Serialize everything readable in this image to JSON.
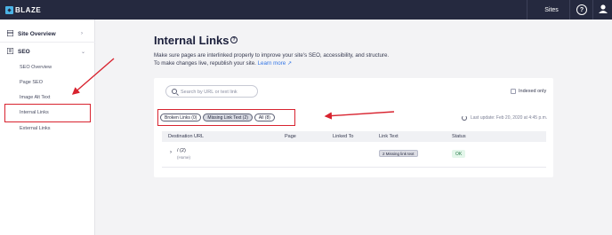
{
  "topbar": {
    "logo": "BLAZE",
    "sites_label": "Sites",
    "help_glyph": "?",
    "icons": {
      "help": "help-circle-icon",
      "user": "user-icon"
    }
  },
  "sidebar": {
    "site_overview": "Site Overview",
    "seo": "SEO",
    "items": [
      {
        "label": "SEO Overview"
      },
      {
        "label": "Page SEO"
      },
      {
        "label": "Image Alt Text"
      },
      {
        "label": "Internal Links"
      },
      {
        "label": "External Links"
      }
    ]
  },
  "main": {
    "title": "Internal Links",
    "info_glyph": "?",
    "description_line1": "Make sure pages are interlinked properly to improve your site's SEO, accessibility, and structure.",
    "description_line2": "To make changes live, republish your site.",
    "learn_more": "Learn more"
  },
  "card": {
    "search_placeholder": "Search by URL or text link",
    "indexed_only": "Indexed only",
    "filters": [
      {
        "label": "Broken Links (0)",
        "active": false
      },
      {
        "label": "Missing Link Text (2)",
        "active": true
      },
      {
        "label": "All (8)",
        "active": false
      }
    ],
    "last_update": "Last update: Feb 20, 2020 at 4:45 p.m.",
    "columns": [
      "Destination URL",
      "Page",
      "Linked To",
      "Link Text",
      "Status"
    ],
    "rows": [
      {
        "url": "/ (2)",
        "sub": "(Home)",
        "link_text": "2 Missing link text",
        "status": "OK"
      }
    ]
  },
  "colors": {
    "topbar": "#25293f",
    "highlight": "#d8232f",
    "accent": "#3375e5",
    "ok": "#267a48"
  }
}
